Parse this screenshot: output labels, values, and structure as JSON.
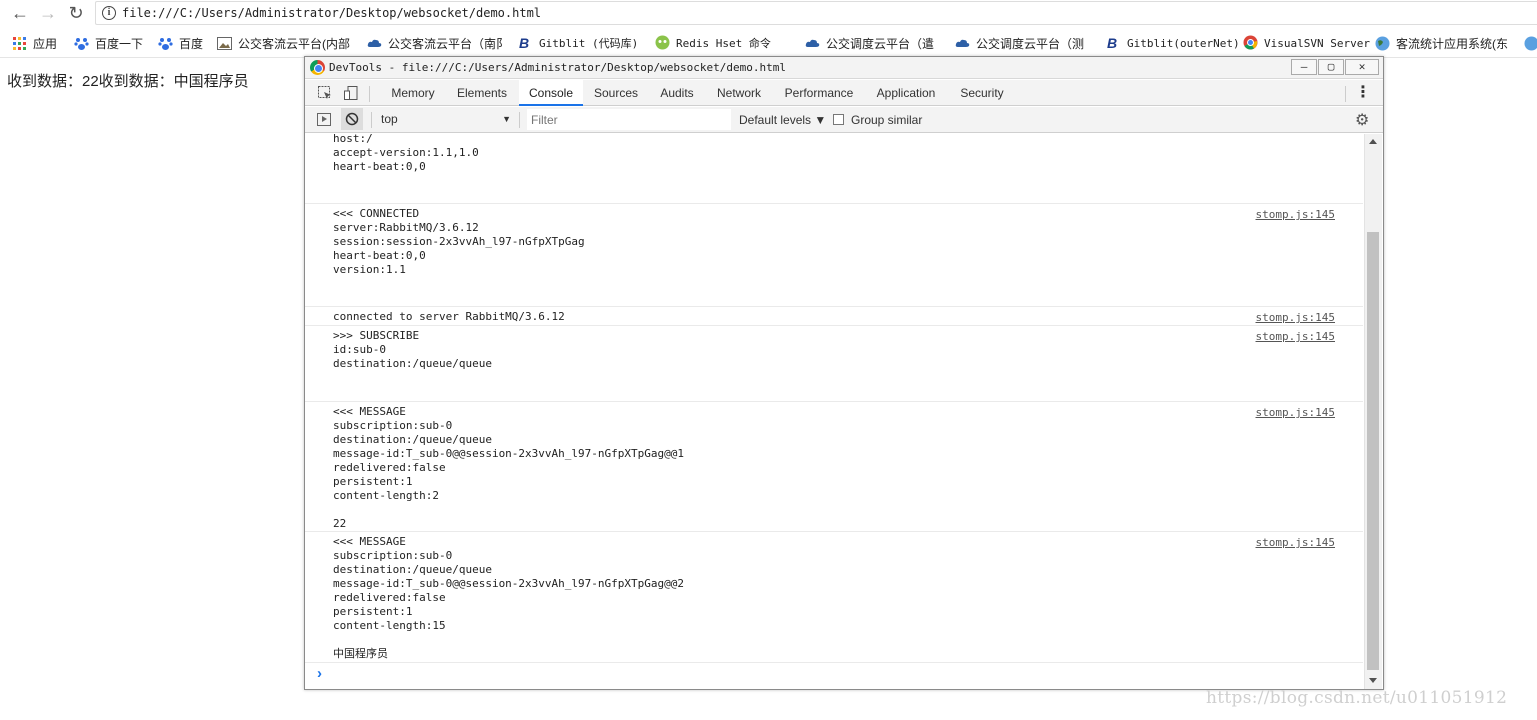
{
  "browser": {
    "url": "file:///C:/Users/Administrator/Desktop/websocket/demo.html",
    "bookmarks": [
      {
        "label": "应用",
        "icon": "apps-grid-icon"
      },
      {
        "label": "百度一下",
        "icon": "baidu-paw-icon"
      },
      {
        "label": "百度",
        "icon": "baidu-paw-icon"
      },
      {
        "label": "公交客流云平台(内部",
        "icon": "image-icon"
      },
      {
        "label": "公交客流云平台（南阝",
        "icon": "cloud-icon"
      },
      {
        "label": "Gitblit (代码库)",
        "icon": "gitblit-icon"
      },
      {
        "label": "Redis Hset 命令",
        "icon": "runoob-icon"
      },
      {
        "label": "公交调度云平台（遣",
        "icon": "cloud-icon"
      },
      {
        "label": "公交调度云平台（测",
        "icon": "cloud-icon"
      },
      {
        "label": "Gitblit(outerNet)",
        "icon": "gitblit-icon"
      },
      {
        "label": "VisualSVN Server",
        "icon": "chrome-icon"
      },
      {
        "label": "客流统计应用系统(东",
        "icon": "globe-icon"
      }
    ]
  },
  "page": {
    "text": "收到数据：22收到数据：中国程序员"
  },
  "devtools": {
    "title": "DevTools - file:///C:/Users/Administrator/Desktop/websocket/demo.html",
    "tabs": [
      "Memory",
      "Elements",
      "Console",
      "Sources",
      "Audits",
      "Network",
      "Performance",
      "Application",
      "Security"
    ],
    "active_tab": "Console",
    "context": "top",
    "filter_placeholder": "Filter",
    "levels": "Default levels ▼",
    "group_similar": "Group similar",
    "messages": [
      {
        "text": "host:/\naccept-version:1.1,1.0\nheart-beat:0,0",
        "source": ""
      },
      {
        "text": "<<< CONNECTED\nserver:RabbitMQ/3.6.12\nsession:session-2x3vvAh_l97-nGfpXTpGag\nheart-beat:0,0\nversion:1.1",
        "source": "stomp.js:145"
      },
      {
        "text": "connected to server RabbitMQ/3.6.12",
        "source": "stomp.js:145"
      },
      {
        "text": ">>> SUBSCRIBE\nid:sub-0\ndestination:/queue/queue",
        "source": "stomp.js:145"
      },
      {
        "text": "<<< MESSAGE\nsubscription:sub-0\ndestination:/queue/queue\nmessage-id:T_sub-0@@session-2x3vvAh_l97-nGfpXTpGag@@1\nredelivered:false\npersistent:1\ncontent-length:2\n\n22",
        "source": "stomp.js:145"
      },
      {
        "text": "<<< MESSAGE\nsubscription:sub-0\ndestination:/queue/queue\nmessage-id:T_sub-0@@session-2x3vvAh_l97-nGfpXTpGag@@2\nredelivered:false\npersistent:1\ncontent-length:15\n\n中国程序员",
        "source": "stomp.js:145"
      }
    ],
    "prompt_symbol": "›"
  },
  "watermark": "https://blog.csdn.net/u011051912"
}
